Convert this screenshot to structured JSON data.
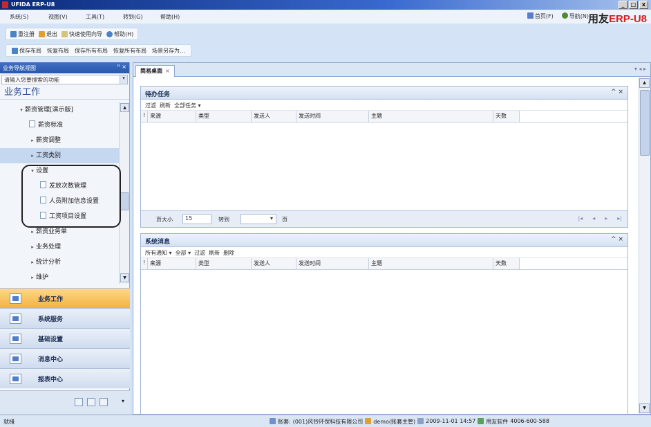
{
  "window": {
    "title": "UFIDA ERP-U8",
    "min": "_",
    "max": "□",
    "close": "x"
  },
  "menu": [
    "系统(S)",
    "视图(V)",
    "工具(T)",
    "转到(G)",
    "帮助(H)"
  ],
  "topnav": {
    "home": "首页(F)",
    "nav": "导航(N)"
  },
  "brand": {
    "main": "用友",
    "erp": "ERP-U8"
  },
  "toolbar1": [
    "重注册",
    "退出",
    "快速使用向导",
    "帮助(H)"
  ],
  "toolbar2": [
    "保存布局",
    "恢复布局",
    "保存所有布局",
    "恢复所有布局",
    "场景另存为..."
  ],
  "left_panel": {
    "header": "业务导航视图",
    "search_placeholder": "请输入您要搜索的功能",
    "section_title": "业务工作",
    "tree": [
      {
        "label": "薪资管理[演示版]",
        "expander": "▾",
        "level": 1
      },
      {
        "label": "薪资标准",
        "expander": "",
        "level": 2
      },
      {
        "label": "薪资调整",
        "expander": "▸",
        "level": 2
      },
      {
        "label": "工资类别",
        "expander": "▸",
        "level": 2
      },
      {
        "label": "设置",
        "expander": "▾",
        "level": 2
      },
      {
        "label": "发放次数管理",
        "expander": "",
        "level": 3
      },
      {
        "label": "人员附加信息设置",
        "expander": "",
        "level": 3
      },
      {
        "label": "工资项目设置",
        "expander": "",
        "level": 3
      },
      {
        "label": "薪资业务单",
        "expander": "▸",
        "level": 2
      },
      {
        "label": "业务处理",
        "expander": "▸",
        "level": 2
      },
      {
        "label": "统计分析",
        "expander": "▸",
        "level": 2
      },
      {
        "label": "维护",
        "expander": "▸",
        "level": 2
      }
    ],
    "nav_buttons": [
      "业务工作",
      "系统服务",
      "基础设置",
      "消息中心",
      "报表中心"
    ]
  },
  "main": {
    "tab": "简易桌面",
    "tasks_panel": {
      "title": "待办任务",
      "tools": [
        "过滤",
        "刷新",
        "全部任务 ▾"
      ],
      "columns": [
        "!",
        "来源",
        "类型",
        "发送人",
        "发送时间",
        "主题",
        "天数"
      ],
      "pager": {
        "page_size_label": "页大小",
        "page_size": "15",
        "goto_label": "转到",
        "page_label": "页"
      }
    },
    "messages_panel": {
      "title": "系统消息",
      "tools": [
        "所有通知 ▾",
        "全部 ▾",
        "过滤",
        "刷新",
        "删除"
      ],
      "columns": [
        "!",
        "来源",
        "类型",
        "发送人",
        "发送时间",
        "主题",
        "天数"
      ]
    }
  },
  "status": {
    "left": "就绪",
    "account_label": "账套:",
    "account": "(001)风铃环保科技有限公司",
    "user": "demo(账套主管)",
    "date": "2009-11-01 14:57",
    "vendor": "用友软件",
    "phone": "4006-600-588"
  }
}
